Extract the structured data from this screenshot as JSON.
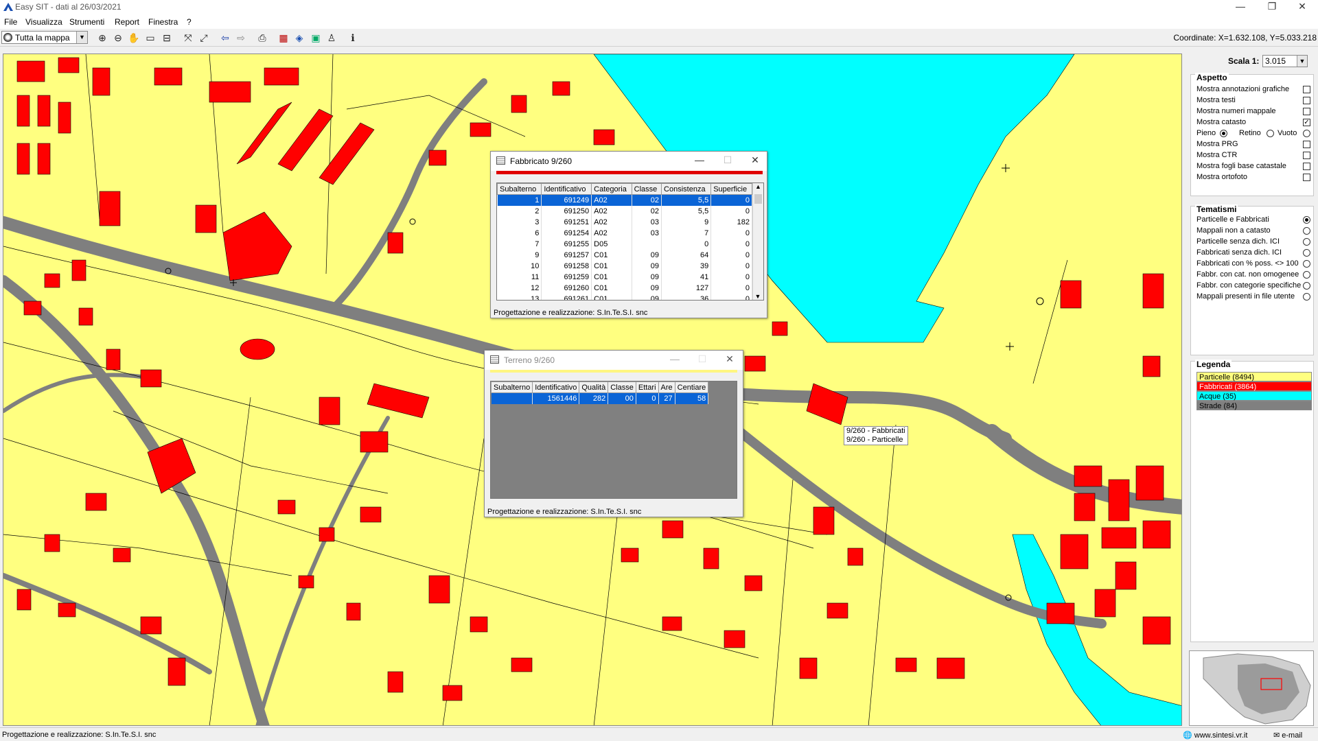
{
  "window": {
    "title": "Easy SIT - dati al 26/03/2021",
    "minimize": "—",
    "restore": "❐",
    "close": "✕"
  },
  "menu": [
    "File",
    "Visualizza",
    "Strumenti",
    "Report",
    "Finestra",
    "?"
  ],
  "toolbar": {
    "view_select": "Tutta la mappa",
    "coordinates": "Coordinate: X=1.632.108, Y=5.033.218"
  },
  "map": {
    "tooltip_line1": "9/260 - Fabbricati",
    "tooltip_line2": "9/260 - Particelle",
    "colors": {
      "particelle": "#ffff80",
      "fabbricati": "#ff0000",
      "acque": "#00ffff",
      "strade": "#808080"
    }
  },
  "fabbricato": {
    "title": "Fabbricato 9/260",
    "columns": [
      "Subalterno",
      "Identificativo",
      "Categoria",
      "Classe",
      "Consistenza",
      "Superficie"
    ],
    "rows": [
      [
        "1",
        "691249",
        "A02",
        "02",
        "5,5",
        "0"
      ],
      [
        "2",
        "691250",
        "A02",
        "02",
        "5,5",
        "0"
      ],
      [
        "3",
        "691251",
        "A02",
        "03",
        "9",
        "182"
      ],
      [
        "6",
        "691254",
        "A02",
        "03",
        "7",
        "0"
      ],
      [
        "7",
        "691255",
        "D05",
        "",
        "0",
        "0"
      ],
      [
        "9",
        "691257",
        "C01",
        "09",
        "64",
        "0"
      ],
      [
        "10",
        "691258",
        "C01",
        "09",
        "39",
        "0"
      ],
      [
        "11",
        "691259",
        "C01",
        "09",
        "41",
        "0"
      ],
      [
        "12",
        "691260",
        "C01",
        "09",
        "127",
        "0"
      ],
      [
        "13",
        "691261",
        "C01",
        "09",
        "36",
        "0"
      ]
    ],
    "footer": "Progettazione e realizzazione: S.In.Te.S.I. snc"
  },
  "terreno": {
    "title": "Terreno 9/260",
    "columns": [
      "Subalterno",
      "Identificativo",
      "Qualità",
      "Classe",
      "Ettari",
      "Are",
      "Centiare"
    ],
    "rows": [
      [
        "",
        "1561446",
        "282",
        "00",
        "0",
        "27",
        "58"
      ]
    ],
    "footer": "Progettazione e realizzazione: S.In.Te.S.I. snc"
  },
  "panel": {
    "scale_label": "Scala 1:",
    "scale_value": "3.015",
    "aspetto": {
      "title": "Aspetto",
      "options": [
        {
          "label": "Mostra annotazioni grafiche",
          "checked": false
        },
        {
          "label": "Mostra testi",
          "checked": false
        },
        {
          "label": "Mostra numeri mappale",
          "checked": false
        },
        {
          "label": "Mostra catasto",
          "checked": true
        }
      ],
      "fill": {
        "pieno": "Pieno",
        "retino": "Retino",
        "vuoto": "Vuoto",
        "selected": "Pieno"
      },
      "options2": [
        {
          "label": "Mostra PRG",
          "checked": false
        },
        {
          "label": "Mostra CTR",
          "checked": false
        },
        {
          "label": "Mostra fogli base catastale",
          "checked": false
        },
        {
          "label": "Mostra ortofoto",
          "checked": false
        }
      ]
    },
    "tematismi": {
      "title": "Tematismi",
      "options": [
        {
          "label": "Particelle e Fabbricati",
          "selected": true
        },
        {
          "label": "Mappali non a catasto",
          "selected": false
        },
        {
          "label": "Particelle senza dich. ICI",
          "selected": false
        },
        {
          "label": "Fabbricati senza dich. ICI",
          "selected": false
        },
        {
          "label": "Fabbricati con % poss. <> 100",
          "selected": false
        },
        {
          "label": "Fabbr. con cat. non omogenee",
          "selected": false
        },
        {
          "label": "Fabbr. con categorie specifiche",
          "selected": false
        },
        {
          "label": "Mappali presenti in file utente",
          "selected": false
        }
      ]
    },
    "legenda": {
      "title": "Legenda",
      "items": [
        {
          "label": "Particelle (8494)",
          "color": "#ffff80",
          "text_color": "#000000"
        },
        {
          "label": "Fabbricati (3864)",
          "color": "#ff0000",
          "text_color": "#ffffff"
        },
        {
          "label": "Acque (35)",
          "color": "#00ffff",
          "text_color": "#000000"
        },
        {
          "label": "Strade (84)",
          "color": "#808080",
          "text_color": "#000000"
        }
      ]
    }
  },
  "status": {
    "left": "Progettazione e realizzazione: S.In.Te.S.I. snc",
    "website": "www.sintesi.vr.it",
    "email": "e-mail"
  }
}
